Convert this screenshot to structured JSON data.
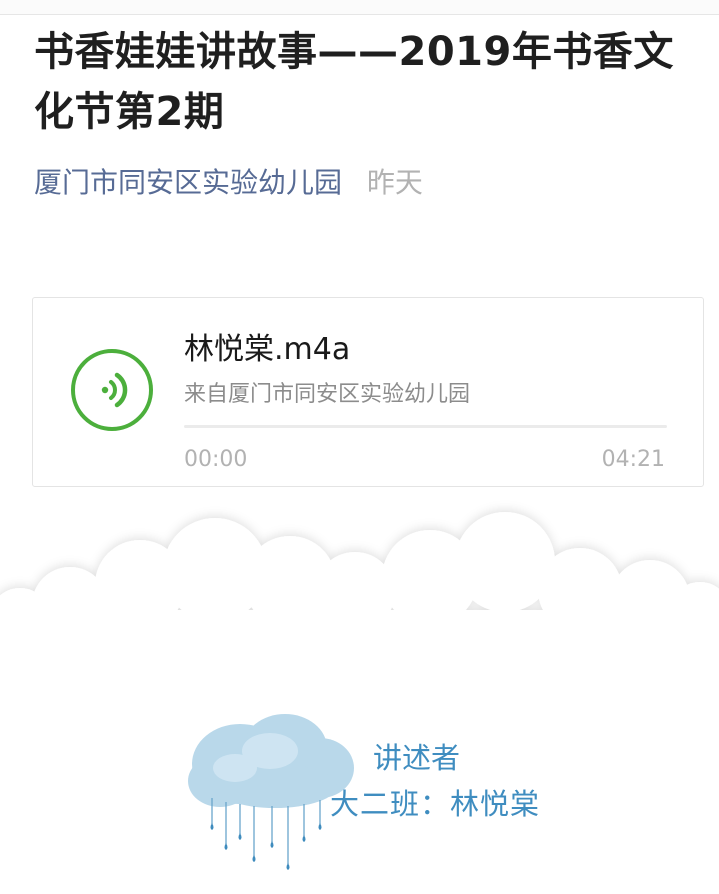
{
  "article": {
    "title": "书香娃娃讲故事——2019年书香文化节第2期",
    "account_name": "厦门市同安区实验幼儿园",
    "publish_date": "昨天"
  },
  "audio": {
    "icon": "audio-wave-icon",
    "file_name": "林悦棠.m4a",
    "source": "来自厦门市同安区实验幼儿园",
    "current_time": "00:00",
    "total_time": "04:21",
    "progress_fraction": 0.0
  },
  "narrator": {
    "label": "讲述者",
    "name": "大二班：林悦棠"
  },
  "colors": {
    "accent_green": "#4caf3c",
    "account_link": "#576b95",
    "narrator_blue": "#3f8dc0",
    "cloud_blue": "#a9cfe6"
  }
}
